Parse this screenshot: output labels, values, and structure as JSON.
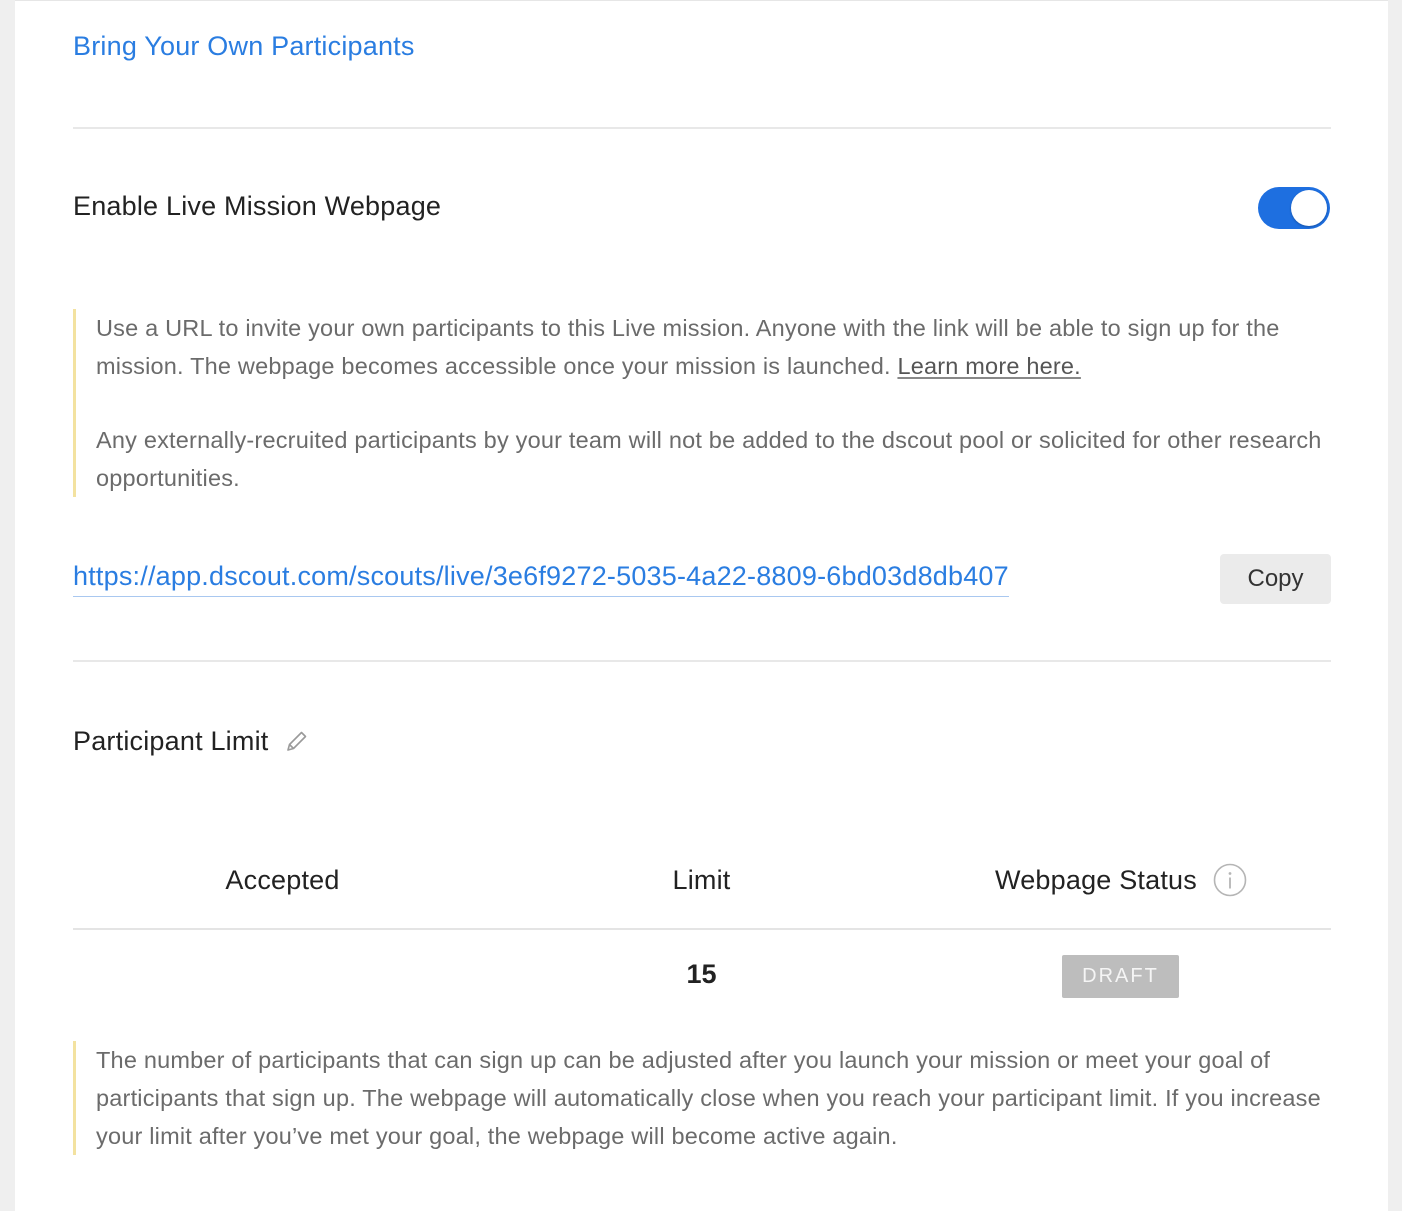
{
  "section": {
    "title": "Bring Your Own Participants"
  },
  "webpage": {
    "toggle_label": "Enable Live Mission Webpage",
    "enabled": true,
    "note_p1_text": "Use a URL to invite your own participants to this Live mission. Anyone with the link will be able to sign up for the mission. The webpage becomes accessible once your mission is launched.",
    "note_p1_link": "Learn more here.",
    "note_p2": "Any externally-recruited participants by your team will not be added to the dscout pool or solicited for other research opportunities.",
    "url": "https://app.dscout.com/scouts/live/3e6f9272-5035-4a22-8809-6bd03d8db407",
    "copy_label": "Copy"
  },
  "participant_limit": {
    "title": "Participant Limit",
    "edit_icon": "pencil-icon",
    "columns": {
      "accepted": "Accepted",
      "limit": "Limit",
      "status": "Webpage Status"
    },
    "status_info_icon": "info-icon",
    "row": {
      "accepted": "",
      "limit": "15",
      "status": "DRAFT"
    },
    "note": "The number of participants that can sign up can be adjusted after you launch your mission or meet your goal of participants that sign up. The webpage will automatically close when you reach your participant limit. If you increase your limit after you’ve met your goal, the webpage will become active again."
  },
  "colors": {
    "link": "#2a7de1",
    "toggle_on": "#1e6fe0",
    "note_border": "#f3e2a0",
    "badge_bg": "#bdbdbd"
  }
}
